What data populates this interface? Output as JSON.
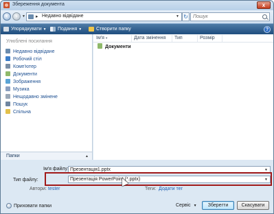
{
  "window": {
    "title": "Збереження документа",
    "close_label": "x"
  },
  "address_bar": {
    "separator": "▸",
    "path": "Недавно відвідане",
    "search_placeholder": "Пошук"
  },
  "toolbar": {
    "organize_label": "Упорядкувати",
    "views_label": "Подання",
    "new_folder_label": "Створити папку",
    "help_label": "?"
  },
  "nav_pane": {
    "heading": "Улюблені посилання",
    "items": [
      {
        "label": "Недавно відвідане",
        "icon": "recent-places-icon",
        "color": "#6b8cae"
      },
      {
        "label": "Робочий стіл",
        "icon": "desktop-icon",
        "color": "#3d7ec9"
      },
      {
        "label": "Комп'ютер",
        "icon": "computer-icon",
        "color": "#7a8fa6"
      },
      {
        "label": "Документи",
        "icon": "documents-icon",
        "color": "#8fb96a"
      },
      {
        "label": "Зображення",
        "icon": "pictures-icon",
        "color": "#5aa4d6"
      },
      {
        "label": "Музика",
        "icon": "music-icon",
        "color": "#8a9fc0"
      },
      {
        "label": "Нещодавно змінене",
        "icon": "recently-changed-icon",
        "color": "#9aa8b8"
      },
      {
        "label": "Пошук",
        "icon": "search-folder-icon",
        "color": "#6f86a0"
      },
      {
        "label": "Спільна",
        "icon": "public-folder-icon",
        "color": "#e3c04a"
      }
    ],
    "folders_label": "Папки",
    "folders_chevron": "▲"
  },
  "file_list": {
    "columns": [
      "Ім'я",
      "Дата змінення",
      "Тип",
      "Розмір"
    ],
    "items": [
      {
        "name": "Документи"
      }
    ]
  },
  "form": {
    "filename_label": "Ім'я файлу:",
    "filename_value": "Презентація1.pptx",
    "filetype_label": "Тип файлу:",
    "filetype_value": "Презентація PowerPoint (*.pptx)",
    "authors_label": "Автори:",
    "authors_value": "tester",
    "tags_label": "Теги:",
    "tags_value": "Додати тег"
  },
  "footer": {
    "hide_folders_label": "Приховати папки",
    "service_label": "Сервіс",
    "save_label": "Зберегти",
    "cancel_label": "Скасувати"
  },
  "colors": {
    "toolbar": "#2f5f8f",
    "highlight_border": "#a01818",
    "link": "#1e5fb2"
  }
}
